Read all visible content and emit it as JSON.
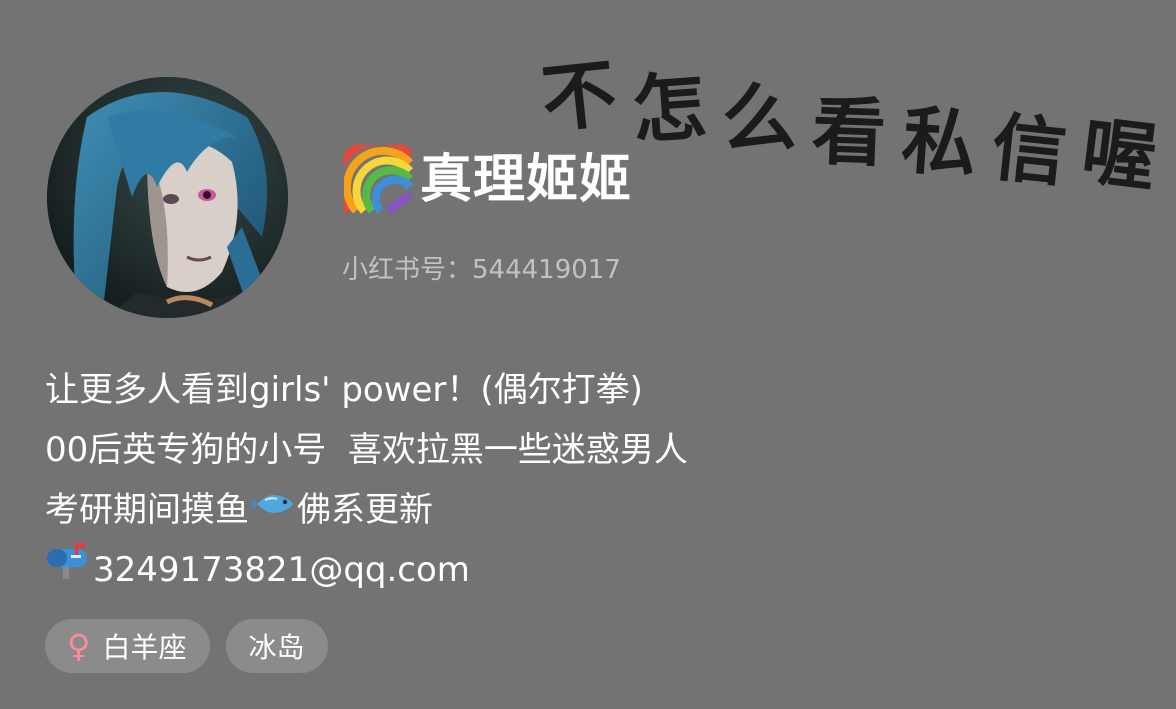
{
  "banner": {
    "text": "不怎么看私信喔",
    "chars": [
      "不",
      "怎",
      "么",
      "看",
      "私",
      "信",
      "喔"
    ]
  },
  "profile": {
    "name": "真理姬姬",
    "name_prefix_icon": "rainbow-icon",
    "id_label": "小红书号：",
    "id_value": "544419017"
  },
  "bio": {
    "line1": "让更多人看到girls' power！(偶尔打拳)",
    "line2": "00后英专狗的小号  喜欢拉黑一些迷惑男人",
    "line3_before": "考研期间摸鱼",
    "line3_icon": "fish-icon",
    "line3_after": "佛系更新",
    "line4_icon": "mailbox-icon",
    "line4_text": "3249173821@qq.com"
  },
  "tags": {
    "zodiac": {
      "icon": "female-icon",
      "icon_glyph": "♀",
      "label": "白羊座"
    },
    "location": {
      "label": "冰岛"
    }
  },
  "colors": {
    "background": "#737373",
    "tag_bg": "#8b8b8b",
    "gender_icon": "#ff8a9c",
    "secondary_text": "#c2c2c2"
  }
}
